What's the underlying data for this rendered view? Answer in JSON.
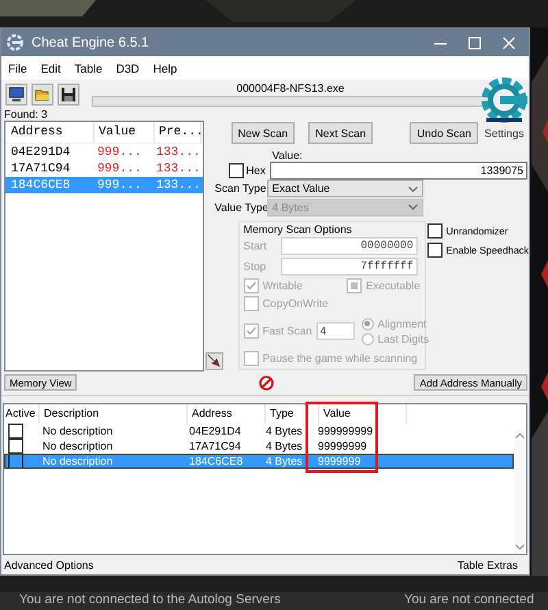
{
  "window": {
    "title": "Cheat Engine 6.5.1",
    "process": "000004F8-NFS13.exe"
  },
  "menu": [
    "File",
    "Edit",
    "Table",
    "D3D",
    "Help"
  ],
  "scan_progress": {
    "level": 0
  },
  "found": "Found: 3",
  "logo_caption": "Settings",
  "results": {
    "columns": [
      "Address",
      "Value",
      "Pre..."
    ],
    "rows": [
      {
        "address": "04E291D4",
        "value": "999...",
        "previous": "133...",
        "selected": false
      },
      {
        "address": "17A71C94",
        "value": "999...",
        "previous": "133...",
        "selected": false
      },
      {
        "address": "184C6CE8",
        "value": "999...",
        "previous": "133...",
        "selected": true
      }
    ]
  },
  "scan_buttons": [
    "New Scan",
    "Next Scan"
  ],
  "undo_button": "Undo Scan",
  "value_label": "Value:",
  "hex": {
    "label": "Hex",
    "checked": false
  },
  "value_input": "1339075",
  "scan_type": {
    "label": "Scan Type",
    "value": "Exact Value",
    "disabled": false
  },
  "value_type": {
    "label": "Value Type",
    "value": "4 Bytes",
    "disabled": true
  },
  "memory_options": {
    "title": "Memory Scan Options",
    "disabled": true,
    "start": {
      "label": "Start",
      "value": "00000000"
    },
    "stop": {
      "label": "Stop",
      "value": "7fffffff"
    },
    "writable": {
      "label": "Writable",
      "checked": true
    },
    "executable": {
      "label": "Executable",
      "indeterminate": true
    },
    "copy_on_write": {
      "label": "CopyOnWrite",
      "checked": false
    },
    "fast_scan": {
      "label": "Fast Scan",
      "checked": true,
      "value": "4"
    },
    "radios": [
      {
        "label": "Alignment",
        "selected": true
      },
      {
        "label": "Last Digits",
        "selected": false
      }
    ],
    "pause": {
      "label": "Pause the game while scanning",
      "checked": false
    }
  },
  "extras": [
    {
      "label": "Unrandomizer",
      "checked": false
    },
    {
      "label": "Enable Speedhack",
      "checked": false
    }
  ],
  "memory_view_button": "Memory View",
  "add_address_button": "Add Address Manually",
  "cheat_table": {
    "columns": [
      {
        "label": "Active",
        "highlighted": false
      },
      {
        "label": "Description",
        "highlighted": false
      },
      {
        "label": "Address",
        "highlighted": false
      },
      {
        "label": "Type",
        "highlighted": false
      },
      {
        "label": "Value",
        "highlighted": true
      }
    ],
    "rows": [
      {
        "active": false,
        "description": "No description",
        "address": "04E291D4",
        "type": "4 Bytes",
        "value": "999999999",
        "selected": false
      },
      {
        "active": false,
        "description": "No description",
        "address": "17A71C94",
        "type": "4 Bytes",
        "value": "99999999",
        "selected": false
      },
      {
        "active": false,
        "description": "No description",
        "address": "184C6CE8",
        "type": "4 Bytes",
        "value": "9999999",
        "selected": true
      }
    ]
  },
  "status_bar": {
    "left": "Advanced Options",
    "right": "Table Extras"
  },
  "background": {
    "kind": "picture",
    "messages": [
      "You are not connected to the Autolog Servers",
      "You are not connected"
    ]
  }
}
